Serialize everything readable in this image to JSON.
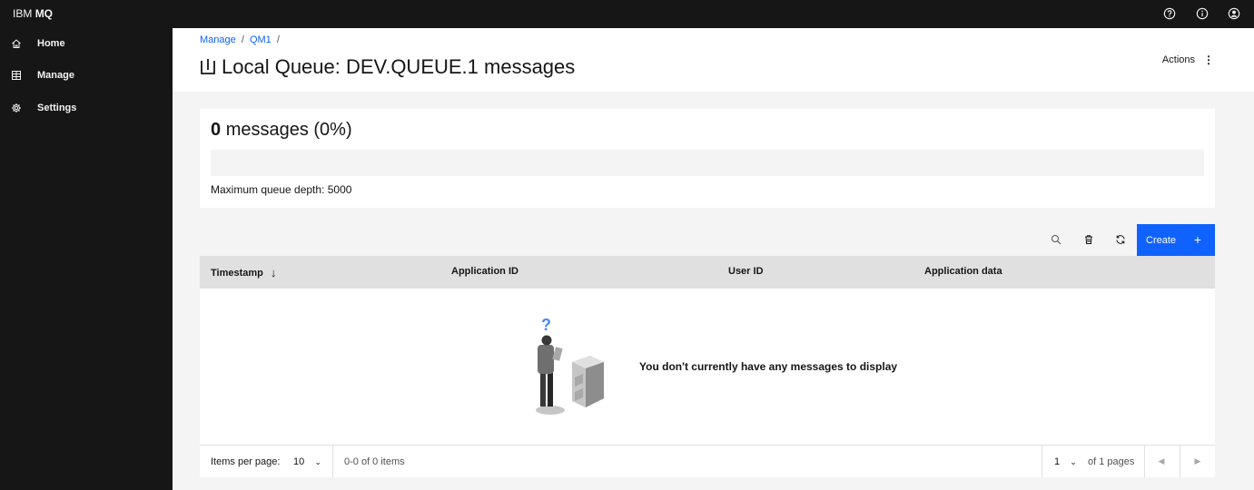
{
  "app": {
    "brand_prefix": "IBM",
    "brand_name": "MQ"
  },
  "header_icons": [
    "help-icon",
    "info-icon",
    "user-avatar-icon"
  ],
  "sidebar": {
    "items": [
      {
        "label": "Home",
        "icon": "home-icon"
      },
      {
        "label": "Manage",
        "icon": "table-icon"
      },
      {
        "label": "Settings",
        "icon": "gear-icon"
      }
    ]
  },
  "breadcrumb": {
    "items": [
      "Manage",
      "QM1"
    ],
    "separator": "/"
  },
  "page": {
    "title": "Local Queue: DEV.QUEUE.1 messages",
    "actions_label": "Actions",
    "actions_kebab": "⋮"
  },
  "depth": {
    "count": "0",
    "label": "messages (0%)",
    "fill_fraction": 0,
    "max_label": "Maximum queue depth: 5000"
  },
  "toolbar": {
    "create_label": "Create",
    "create_plus": "+"
  },
  "table": {
    "columns": [
      "Timestamp",
      "Application ID",
      "User ID",
      "Application data"
    ],
    "sort_arrow": "↓",
    "empty_message": "You don't currently have any messages to display"
  },
  "pagination": {
    "items_per_page_label": "Items per page:",
    "items_per_page_value": "10",
    "range_text": "0-0 of 0 items",
    "page_value": "1",
    "pages_text": "of 1 pages"
  },
  "colors": {
    "accent": "#0f62fe",
    "header_bg": "#161616",
    "page_bg": "#f4f4f4"
  }
}
